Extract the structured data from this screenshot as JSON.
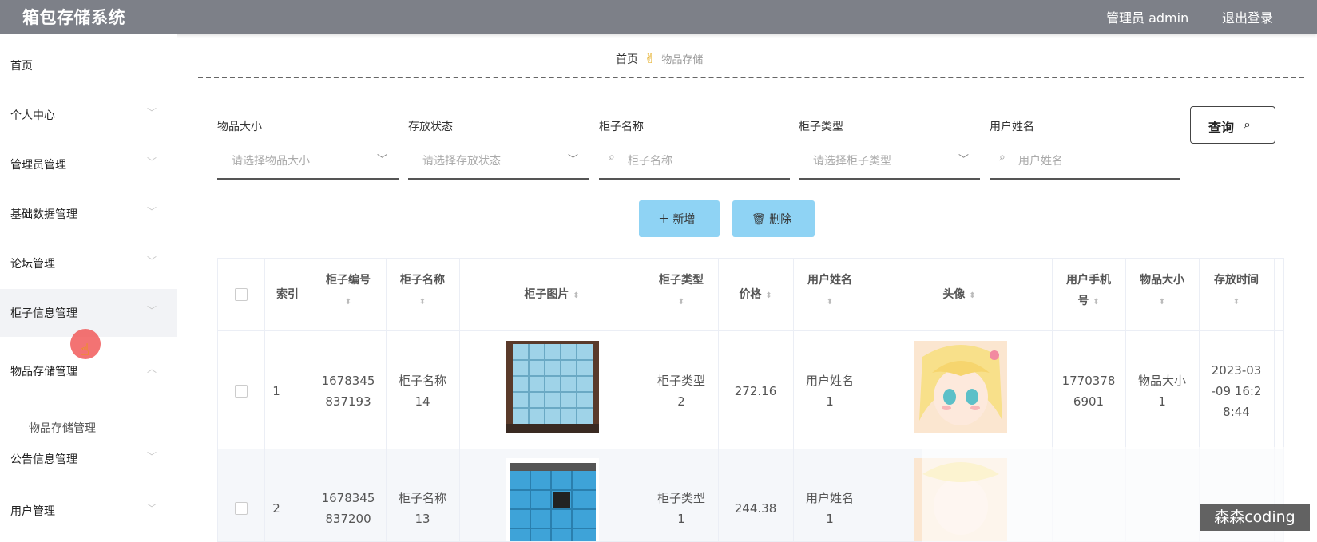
{
  "header": {
    "title": "箱包存储系统",
    "admin": "管理员 admin",
    "logout": "退出登录"
  },
  "sidebar": {
    "items": [
      {
        "label": "首页"
      },
      {
        "label": "个人中心"
      },
      {
        "label": "管理员管理"
      },
      {
        "label": "基础数据管理"
      },
      {
        "label": "论坛管理"
      },
      {
        "label": "柜子信息管理"
      },
      {
        "label": "物品存储管理"
      },
      {
        "label": "公告信息管理"
      },
      {
        "label": "用户管理"
      }
    ],
    "sub_item": "物品存储管理"
  },
  "breadcrumb": {
    "home": "首页",
    "current": "物品存储"
  },
  "search": {
    "fields": [
      {
        "label": "物品大小",
        "placeholder": "请选择物品大小"
      },
      {
        "label": "存放状态",
        "placeholder": "请选择存放状态"
      },
      {
        "label": "柜子名称",
        "placeholder": "柜子名称"
      },
      {
        "label": "柜子类型",
        "placeholder": "请选择柜子类型"
      },
      {
        "label": "用户姓名",
        "placeholder": "用户姓名"
      }
    ],
    "query_label": "查询"
  },
  "actions": {
    "add_label": "新增",
    "delete_label": "删除"
  },
  "table": {
    "headers": {
      "index": "索引",
      "cabinet_no_1": "柜子编号",
      "cabinet_name": "柜子名称",
      "cabinet_image": "柜子图片",
      "cabinet_type": "柜子类型",
      "price": "价格",
      "user_name": "用户姓名",
      "avatar": "头像",
      "phone_1": "用户手机",
      "phone_2": "号",
      "item_size": "物品大小",
      "store_time": "存放时间"
    },
    "rows": [
      {
        "index": "1",
        "no_1": "1678345",
        "no_2": "837193",
        "name_1": "柜子名称",
        "name_2": "14",
        "type_1": "柜子类型",
        "type_2": "2",
        "price": "272.16",
        "user_1": "用户姓名",
        "user_2": "1",
        "phone_1": "1770378",
        "phone_2": "6901",
        "size_1": "物品大小",
        "size_2": "1",
        "time_1": "2023-03",
        "time_2": "-09 16:2",
        "time_3": "8:44"
      },
      {
        "index": "2",
        "no_1": "1678345",
        "no_2": "837200",
        "name_1": "柜子名称",
        "name_2": "13",
        "type_1": "柜子类型",
        "type_2": "1",
        "price": "244.38",
        "user_1": "用户姓名",
        "user_2": "1"
      }
    ]
  },
  "watermark": "森森coding",
  "colors": {
    "header_bg": "#7d8088",
    "button_bg": "#8fd3f4",
    "active_bg": "#f2f3f6"
  }
}
